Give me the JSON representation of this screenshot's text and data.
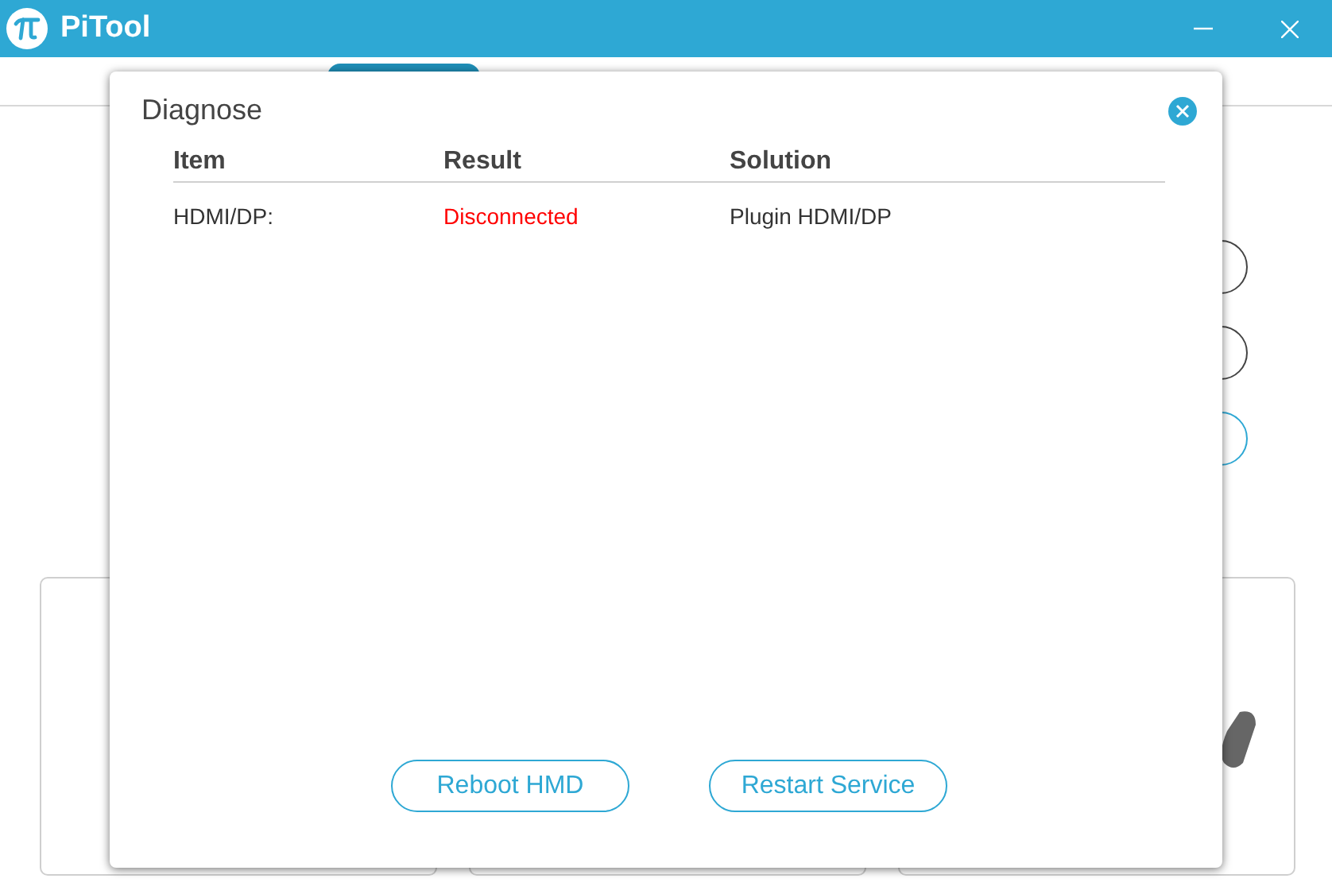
{
  "window": {
    "title": "PiTool"
  },
  "dialog": {
    "title": "Diagnose",
    "columns": [
      "Item",
      "Result",
      "Solution"
    ],
    "rows": [
      {
        "item": "HDMI/DP:",
        "result": "Disconnected",
        "color": "#ff0000",
        "solution": "Plugin HDMI/DP"
      }
    ],
    "buttons": [
      "Reboot HMD",
      "Restart Service"
    ]
  }
}
